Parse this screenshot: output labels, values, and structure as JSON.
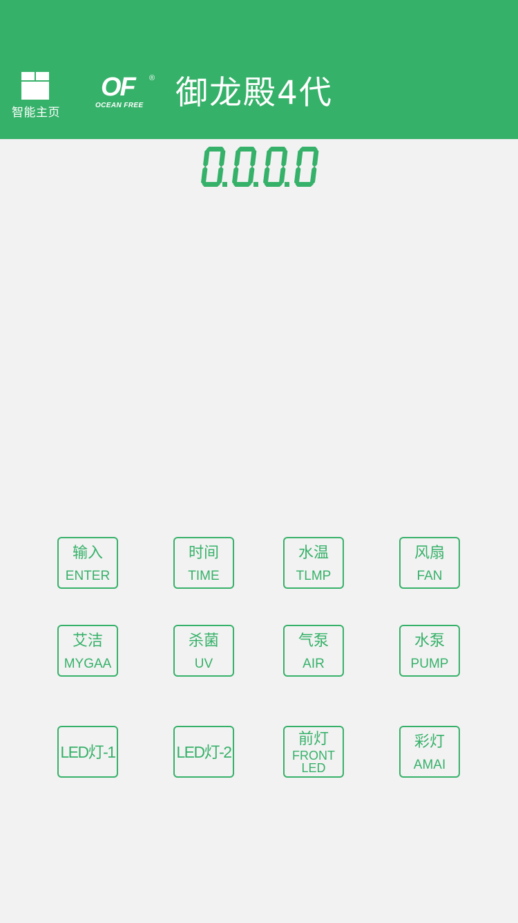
{
  "header": {
    "home_label": "智能主页",
    "home_icon": "grid-home-icon",
    "logo_mark": "OF",
    "logo_text": "OCEAN FREE",
    "logo_registered": "®",
    "title": "御龙殿4代",
    "background_color": "#36b169"
  },
  "display": {
    "value": "0.0.0.0",
    "color": "#36b169"
  },
  "controls": {
    "accent_color": "#36b169",
    "rows": [
      [
        {
          "cn": "输入",
          "en": "ENTER"
        },
        {
          "cn": "时间",
          "en": "TIME"
        },
        {
          "cn": "水温",
          "en": "TLMP"
        },
        {
          "cn": "风扇",
          "en": "FAN"
        }
      ],
      [
        {
          "cn": "艾洁",
          "en": "MYGAA"
        },
        {
          "cn": "杀菌",
          "en": "UV"
        },
        {
          "cn": "气泵",
          "en": "AIR"
        },
        {
          "cn": "水泵",
          "en": "PUMP"
        }
      ],
      [
        {
          "label": "LED灯-1"
        },
        {
          "label": "LED灯-2"
        },
        {
          "cn": "前灯",
          "en_line1": "FRONT",
          "en_line2": "LED"
        },
        {
          "cn": "彩灯",
          "en": "AMAI"
        }
      ]
    ]
  }
}
